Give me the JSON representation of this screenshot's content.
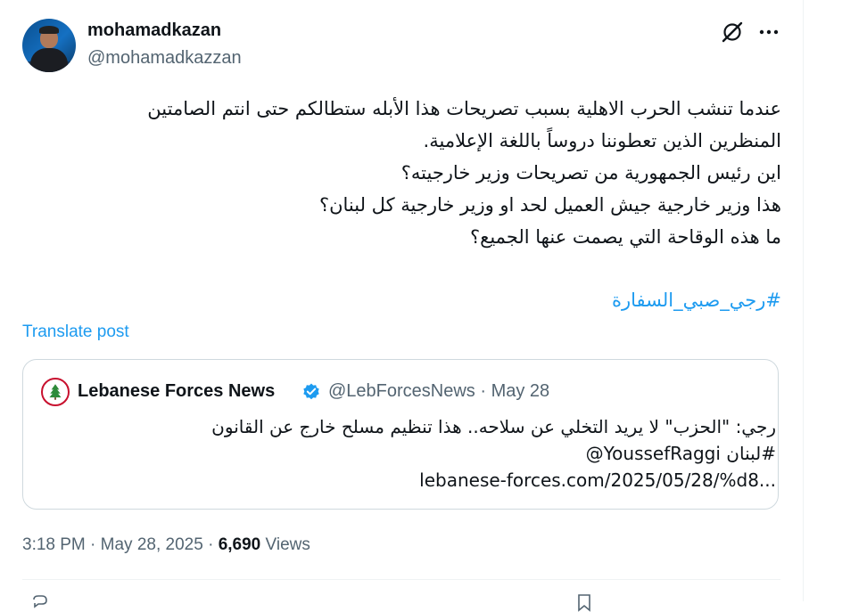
{
  "author": {
    "name": "mohamadkazan",
    "handle": "@mohamadkazzan"
  },
  "tweet": {
    "lines": [
      "عندما تنشب الحرب الاهلية بسبب تصريحات هذا الأبله ستطالكم حتى انتم الصامتين",
      "المنظرين الذين تعطوننا دروساً باللغة الإعلامية.",
      "اين رئيس الجمهورية من تصريحات وزير خارجيته؟",
      "هذا وزير خارجية جيش العميل لحد او وزير خارجية كل لبنان؟",
      "ما هذه الوقاحة التي يصمت عنها الجميع؟"
    ],
    "hashtag": "#رجي_صبي_السفارة",
    "translate_label": "Translate post"
  },
  "quote": {
    "name": "Lebanese Forces News",
    "handle": "@LebForcesNews",
    "separator": " · ",
    "date": "May 28",
    "line1": "رجي: \"الحزب\" لا يريد التخلي عن سلاحه.. هذا تنظيم مسلح خارج عن القانون",
    "line2_hashtag": "#لبنان",
    "line2_mention": "@YoussefRaggi",
    "link": "lebanese-forces.com/2025/05/28/%d8..."
  },
  "meta": {
    "time": "3:18 PM",
    "separator": " · ",
    "date": "May 28, 2025",
    "views_count": "6,690",
    "views_label": " Views"
  },
  "colors": {
    "accent": "#1d9bf0",
    "secondary_text": "#536471",
    "primary_text": "#0f1419",
    "border": "#cfd9de",
    "cedar_green": "#2e8b3a",
    "lf_red": "#c8102e"
  },
  "icons": {
    "grok": "grok-slash-circle-icon",
    "more": "more-horizontal-icon",
    "verified": "verified-badge-icon",
    "cedar": "lebanese-cedar-logo"
  }
}
